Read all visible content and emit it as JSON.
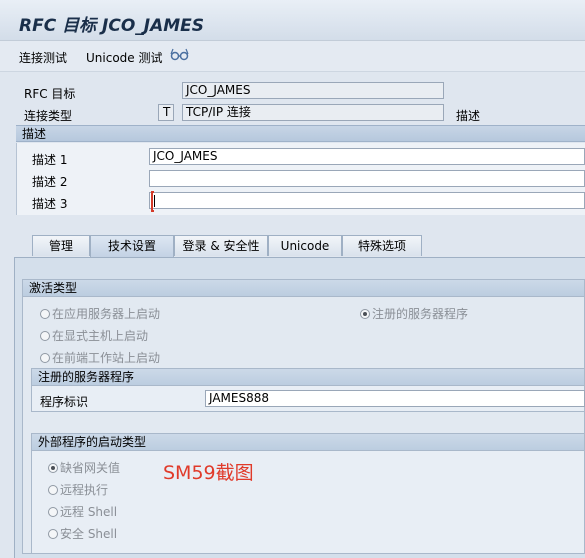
{
  "window": {
    "title": "RFC 目标 JCO_JAMES"
  },
  "toolbar": {
    "connection_test": "连接测试",
    "unicode_test": "Unicode 测试"
  },
  "header": {
    "rfc_target_label": "RFC 目标",
    "rfc_target_value": "JCO_JAMES",
    "connection_type_label": "连接类型",
    "connection_type_code": "T",
    "connection_type_value": "TCP/IP 连接",
    "description_label": "描述"
  },
  "description": {
    "section_title": "描述",
    "desc1_label": "描述 1",
    "desc1_value": "JCO_JAMES",
    "desc2_label": "描述 2",
    "desc2_value": "",
    "desc3_label": "描述 3",
    "desc3_value": ""
  },
  "tabs": [
    {
      "label": "管理"
    },
    {
      "label": "技术设置",
      "active": true
    },
    {
      "label": "登录 & 安全性"
    },
    {
      "label": "Unicode"
    },
    {
      "label": "特殊选项"
    }
  ],
  "activation": {
    "title": "激活类型",
    "options": [
      {
        "label": "在应用服务器上启动",
        "selected": false
      },
      {
        "label": "在显式主机上启动",
        "selected": false
      },
      {
        "label": "在前端工作站上启动",
        "selected": false
      },
      {
        "label": "注册的服务器程序",
        "selected": true
      }
    ]
  },
  "registered": {
    "title": "注册的服务器程序",
    "program_id_label": "程序标识",
    "program_id_value": "JAMES888"
  },
  "external": {
    "title": "外部程序的启动类型",
    "options": [
      {
        "label": "缺省网关值",
        "selected": true
      },
      {
        "label": "远程执行",
        "selected": false
      },
      {
        "label": "远程 Shell",
        "selected": false
      },
      {
        "label": "安全 Shell",
        "selected": false
      }
    ]
  },
  "annotation": {
    "caption": "SM59截图"
  },
  "colors": {
    "caption": "#e03a2a",
    "accent": "#1a2f4a"
  }
}
